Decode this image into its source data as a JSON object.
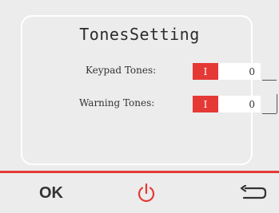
{
  "dialog": {
    "title": "TonesSetting",
    "rows": [
      {
        "label": "Keypad Tones:",
        "on_label": "I",
        "off_label": "0"
      },
      {
        "label": "Warning Tones:",
        "on_label": "I",
        "off_label": "0"
      }
    ]
  },
  "footer": {
    "ok_label": "OK",
    "power_icon": "power-icon",
    "back_icon": "back-arrow-icon"
  },
  "colors": {
    "accent": "#e53935",
    "background": "#ececec",
    "text": "#333333"
  }
}
